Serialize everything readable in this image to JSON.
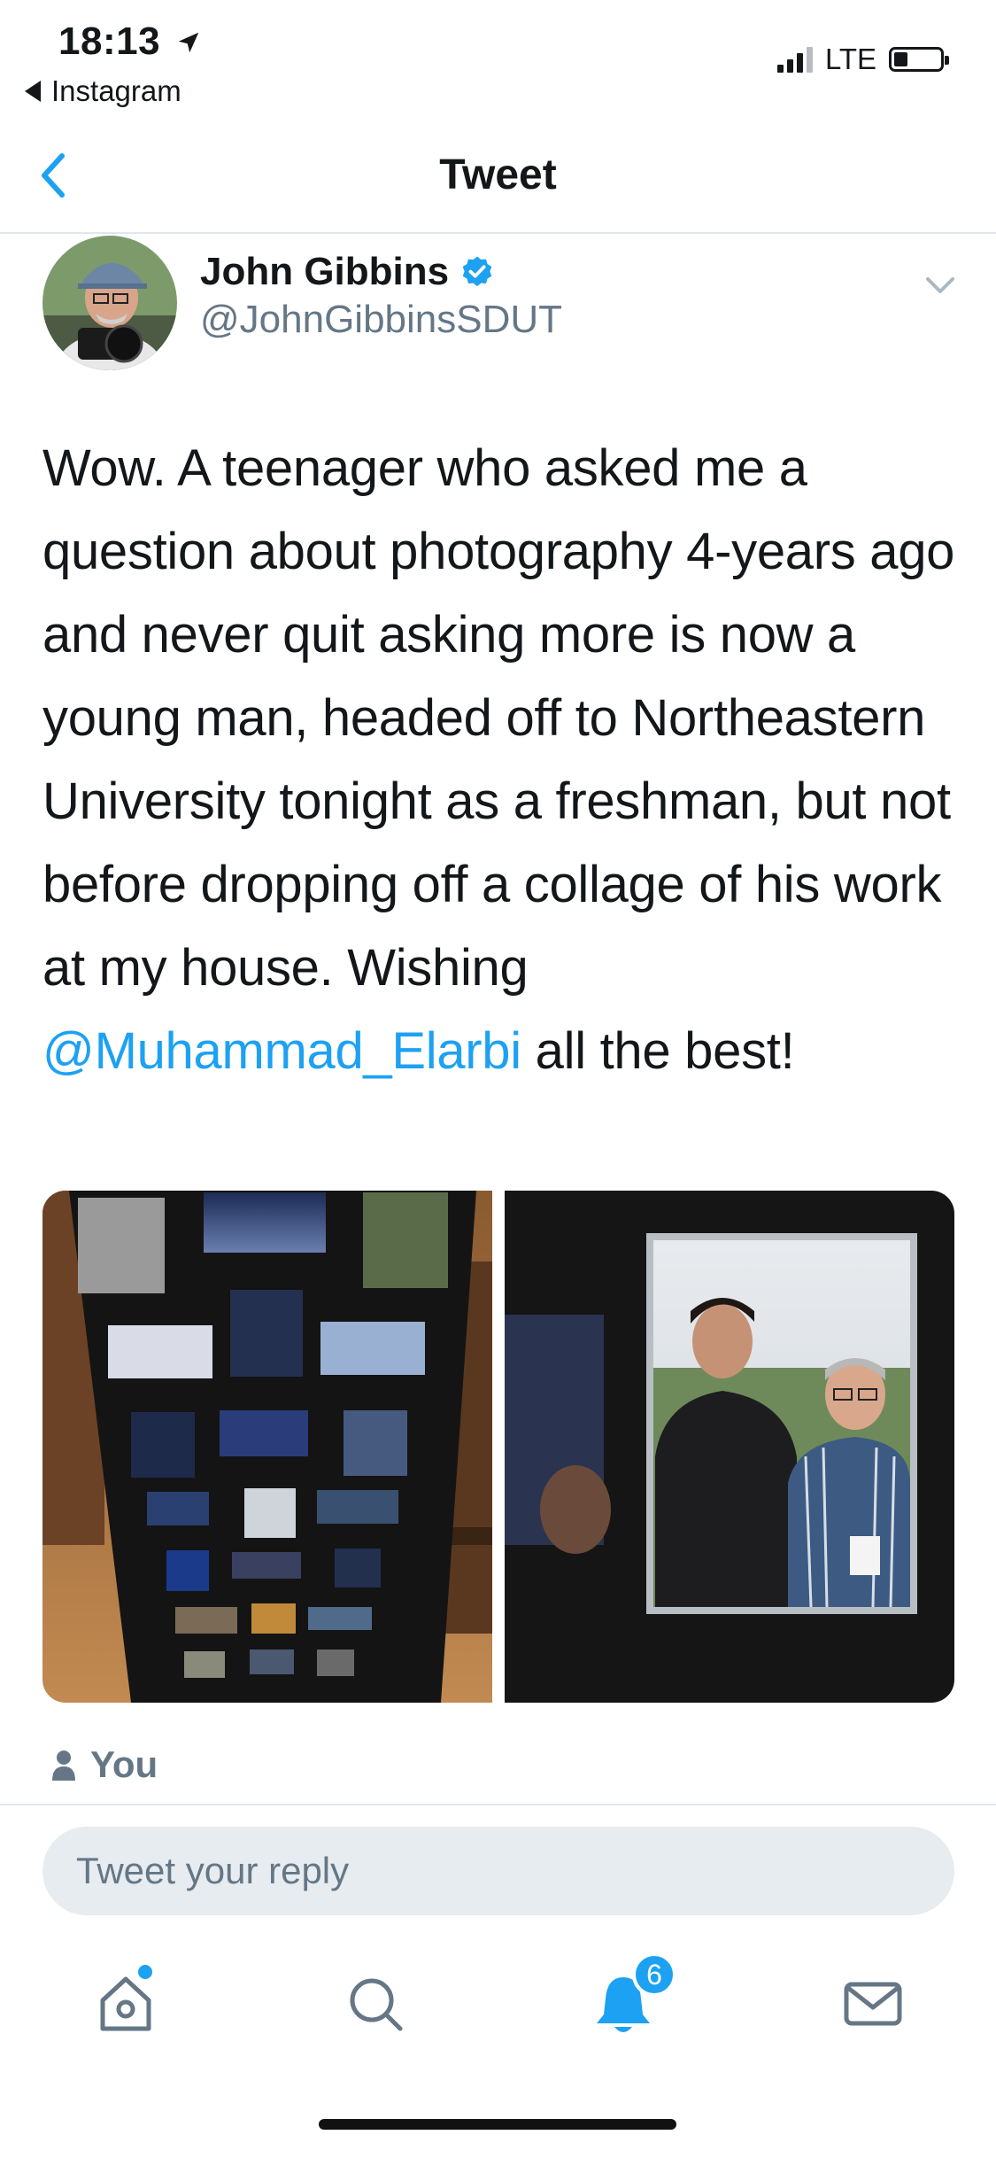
{
  "status_bar": {
    "time": "18:13",
    "back_app": "Instagram",
    "network": "LTE",
    "battery_fraction": 0.3
  },
  "nav": {
    "title": "Tweet"
  },
  "tweet": {
    "author_name": "John Gibbins",
    "author_handle": "@JohnGibbinsSDUT",
    "verified": true,
    "text_before_mention": "Wow. A teenager who asked me a question about photography 4-years ago and never quit asking more is now a young man, headed off to Northeastern University tonight as a freshman, but not before dropping off a collage of his work at my house. Wishing ",
    "mention": "@Muhammad_Elarbi",
    "text_after_mention": " all the best!",
    "media_count": 2
  },
  "reply": {
    "you_label": "You",
    "placeholder": "Tweet your reply"
  },
  "tab_bar": {
    "items": [
      "home-icon",
      "search-icon",
      "bell-icon",
      "mail-icon"
    ],
    "notification_count": "6",
    "home_has_new": true
  },
  "colors": {
    "accent": "#1da1f2",
    "secondary_text": "#657786",
    "divider": "#e1e8ed",
    "input_bg": "#e6ecf0"
  }
}
